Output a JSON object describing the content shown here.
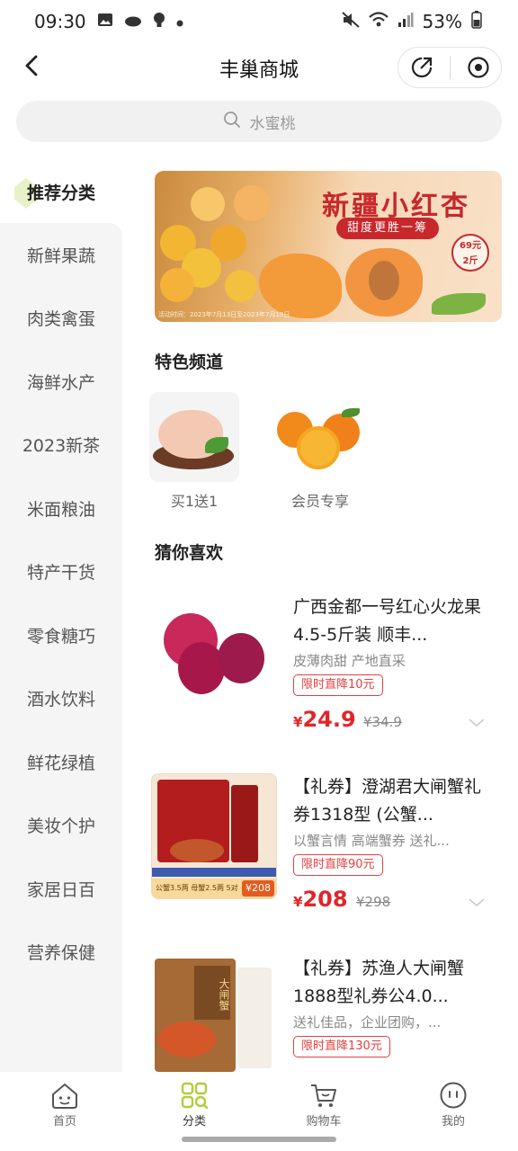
{
  "status_bar": {
    "time": "09:30",
    "battery": "53%",
    "icons": [
      "image-icon",
      "cloud-icon",
      "bulb-icon",
      "dot-icon",
      "mute-icon",
      "wifi-icon",
      "signal-icon",
      "battery-icon"
    ]
  },
  "nav": {
    "title": "丰巢商城",
    "back_icon": "back-arrow-icon",
    "share_icon": "share-icon",
    "close_icon": "target-icon"
  },
  "search": {
    "placeholder": "水蜜桃"
  },
  "sidebar": {
    "items": [
      {
        "label": "推荐分类",
        "active": true
      },
      {
        "label": "新鲜果蔬"
      },
      {
        "label": "肉类禽蛋"
      },
      {
        "label": "海鲜水产"
      },
      {
        "label": "2023新茶"
      },
      {
        "label": "米面粮油"
      },
      {
        "label": "特产干货"
      },
      {
        "label": "零食糖巧"
      },
      {
        "label": "酒水饮料"
      },
      {
        "label": "鲜花绿植"
      },
      {
        "label": "美妆个护"
      },
      {
        "label": "家居日百"
      },
      {
        "label": "营养保健"
      }
    ]
  },
  "banner": {
    "title": "新疆小红杏",
    "subtitle": "甜度更胜一筹",
    "price_line1": "69元",
    "price_line2": "2斤",
    "date_text": "活动时间：2023年7月13日至2023年7月19日"
  },
  "featured": {
    "title": "特色频道",
    "channels": [
      {
        "label": "买1送1"
      },
      {
        "label": "会员专享"
      }
    ]
  },
  "guess": {
    "title": "猜你喜欢",
    "products": [
      {
        "name": "广西金都一号红心火龙果4.5-5斤装 顺丰...",
        "desc": "皮薄肉甜 产地直采",
        "tag": "限时直降10元",
        "currency": "¥",
        "price": "24.9",
        "old_price": "¥34.9"
      },
      {
        "name": "【礼券】澄湖君大闸蟹礼券1318型 (公蟹...",
        "desc": "以蟹言情 高端蟹券 送礼...",
        "tag": "限时直降90元",
        "currency": "¥",
        "price": "208",
        "old_price": "¥298",
        "img_caption": "公蟹3.5两 母蟹2.5两 5对",
        "img_price": "¥208"
      },
      {
        "name": "【礼券】苏渔人大闸蟹1888型礼券公4.0...",
        "desc": "送礼佳品，企业团购，...",
        "tag": "限时直降130元",
        "img_text": "大闸蟹"
      }
    ]
  },
  "tabbar": {
    "tabs": [
      {
        "label": "首页",
        "icon": "home-face-icon"
      },
      {
        "label": "分类",
        "icon": "category-icon",
        "active": true
      },
      {
        "label": "购物车",
        "icon": "cart-icon"
      },
      {
        "label": "我的",
        "icon": "profile-icon"
      }
    ]
  },
  "colors": {
    "accent_green": "#b3cc3a",
    "price_red": "#e0262b",
    "banner_red": "#c8272b"
  }
}
